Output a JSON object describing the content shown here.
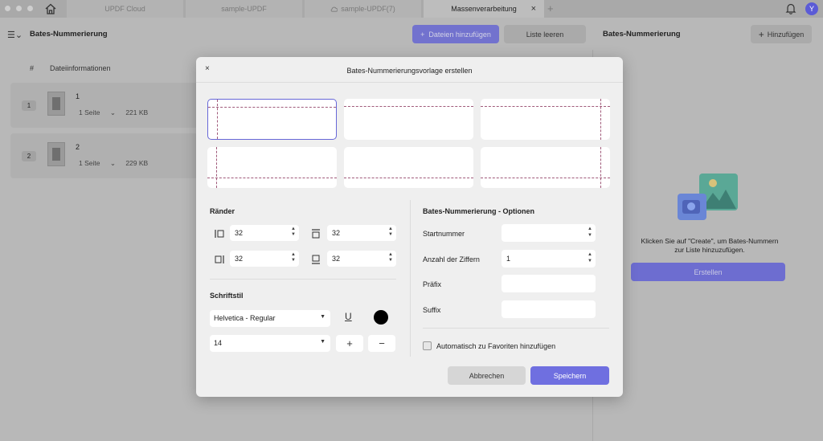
{
  "tabs": [
    {
      "label": "UPDF Cloud"
    },
    {
      "label": "sample-UPDF"
    },
    {
      "label": "sample-UPDF(7)"
    },
    {
      "label": "Massenverarbeitung",
      "close": "×"
    }
  ],
  "new_tab": "+",
  "avatar_initial": "Y",
  "toolbar": {
    "title": "Bates-Nummerierung",
    "add_files": "Dateien hinzufügen",
    "clear_list": "Liste leeren",
    "right_title": "Bates-Nummerierung",
    "add": "Hinzufügen"
  },
  "list": {
    "col_num": "#",
    "col_info": "Dateiinformationen",
    "rows": [
      {
        "num": "1",
        "name": "1",
        "pages": "1 Seite",
        "size": "221 KB"
      },
      {
        "num": "2",
        "name": "2",
        "pages": "1 Seite",
        "size": "229 KB"
      }
    ]
  },
  "right_panel": {
    "hint_line1": "Klicken Sie auf \"Create\", um Bates-Nummern",
    "hint_line2": "zur Liste hinzuzufügen.",
    "create_button": "Erstellen"
  },
  "modal": {
    "close": "×",
    "title": "Bates-Nummerierungsvorlage erstellen",
    "margins_title": "Ränder",
    "margin_left": "32",
    "margin_top": "32",
    "margin_right": "32",
    "margin_bottom": "32",
    "font_title": "Schriftstil",
    "font": "Helvetica - Regular",
    "font_size": "14",
    "underline": "U",
    "options_title": "Bates-Nummerierung - Optionen",
    "start_label": "Startnummer",
    "start_value": "",
    "digits_label": "Anzahl der Ziffern",
    "digits_value": "1",
    "prefix_label": "Präfix",
    "prefix_value": "",
    "suffix_label": "Suffix",
    "suffix_value": "",
    "favorites_label": "Automatisch zu Favoriten hinzufügen",
    "cancel": "Abbrechen",
    "save": "Speichern"
  },
  "colors": {
    "accent": "#5b5bd6",
    "save": "#6f6fe0",
    "text_color_swatch": "#000000"
  }
}
